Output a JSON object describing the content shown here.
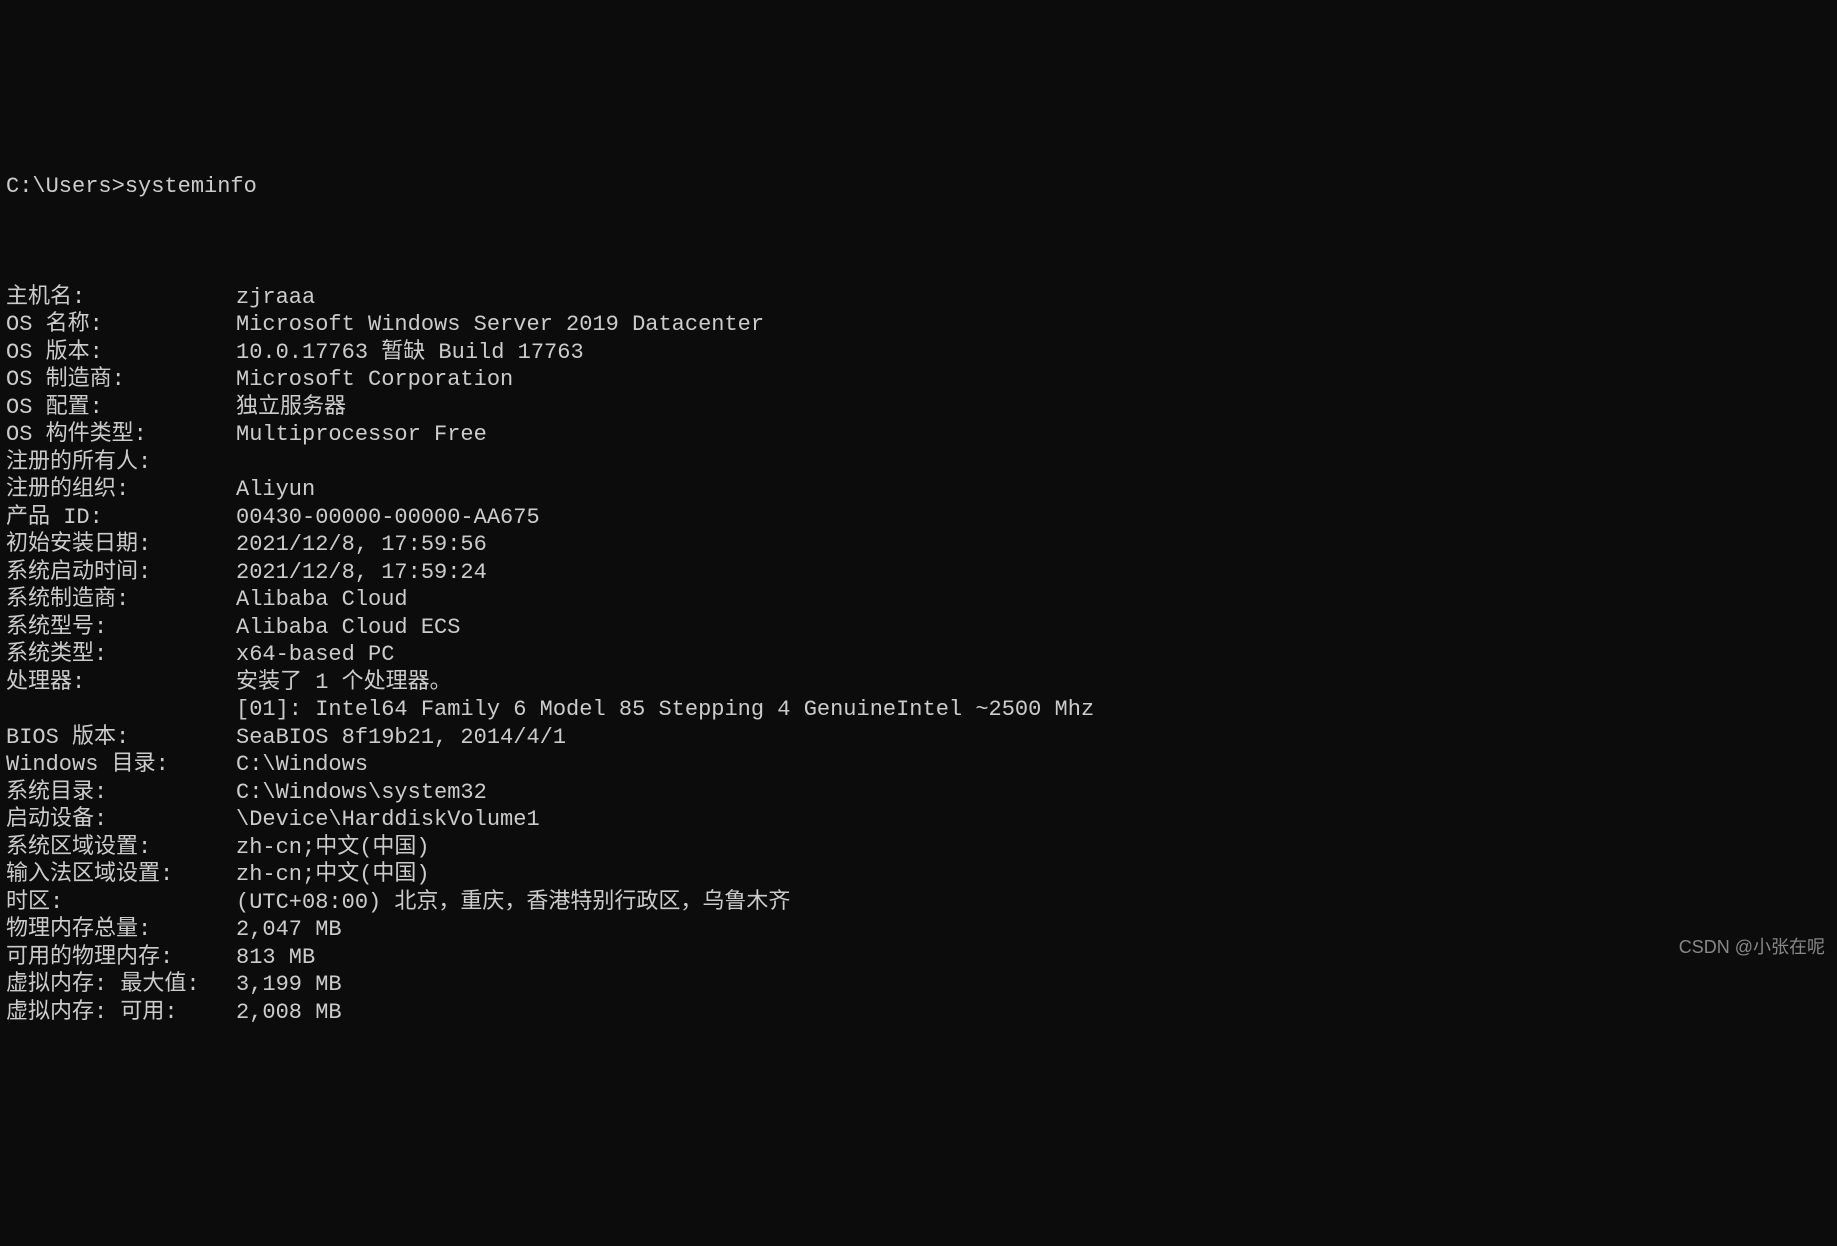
{
  "prompt": "C:\\Users>systeminfo",
  "rows": [
    {
      "label": "主机名:",
      "value": "zjraaa"
    },
    {
      "label": "OS 名称:",
      "value": "Microsoft Windows Server 2019 Datacenter"
    },
    {
      "label": "OS 版本:",
      "value": "10.0.17763 暂缺 Build 17763"
    },
    {
      "label": "OS 制造商:",
      "value": "Microsoft Corporation"
    },
    {
      "label": "OS 配置:",
      "value": "独立服务器"
    },
    {
      "label": "OS 构件类型:",
      "value": "Multiprocessor Free"
    },
    {
      "label": "注册的所有人:",
      "value": ""
    },
    {
      "label": "注册的组织:",
      "value": "Aliyun"
    },
    {
      "label": "产品 ID:",
      "value": "00430-00000-00000-AA675"
    },
    {
      "label": "初始安装日期:",
      "value": "2021/12/8, 17:59:56"
    },
    {
      "label": "系统启动时间:",
      "value": "2021/12/8, 17:59:24"
    },
    {
      "label": "系统制造商:",
      "value": "Alibaba Cloud"
    },
    {
      "label": "系统型号:",
      "value": "Alibaba Cloud ECS"
    },
    {
      "label": "系统类型:",
      "value": "x64-based PC"
    },
    {
      "label": "处理器:",
      "value": "安装了 1 个处理器。"
    },
    {
      "label": "",
      "value": "[01]: Intel64 Family 6 Model 85 Stepping 4 GenuineIntel ~2500 Mhz"
    },
    {
      "label": "BIOS 版本:",
      "value": "SeaBIOS 8f19b21, 2014/4/1"
    },
    {
      "label": "Windows 目录:",
      "value": "C:\\Windows"
    },
    {
      "label": "系统目录:",
      "value": "C:\\Windows\\system32"
    },
    {
      "label": "启动设备:",
      "value": "\\Device\\HarddiskVolume1"
    },
    {
      "label": "系统区域设置:",
      "value": "zh-cn;中文(中国)"
    },
    {
      "label": "输入法区域设置:",
      "value": "zh-cn;中文(中国)"
    },
    {
      "label": "时区:",
      "value": "(UTC+08:00) 北京，重庆，香港特别行政区，乌鲁木齐"
    },
    {
      "label": "物理内存总量:",
      "value": "2,047 MB"
    },
    {
      "label": "可用的物理内存:",
      "value": "813 MB"
    },
    {
      "label": "虚拟内存: 最大值:",
      "value": "3,199 MB"
    },
    {
      "label": "虚拟内存: 可用:",
      "value": "2,008 MB"
    }
  ],
  "watermark": "CSDN @小张在呢"
}
